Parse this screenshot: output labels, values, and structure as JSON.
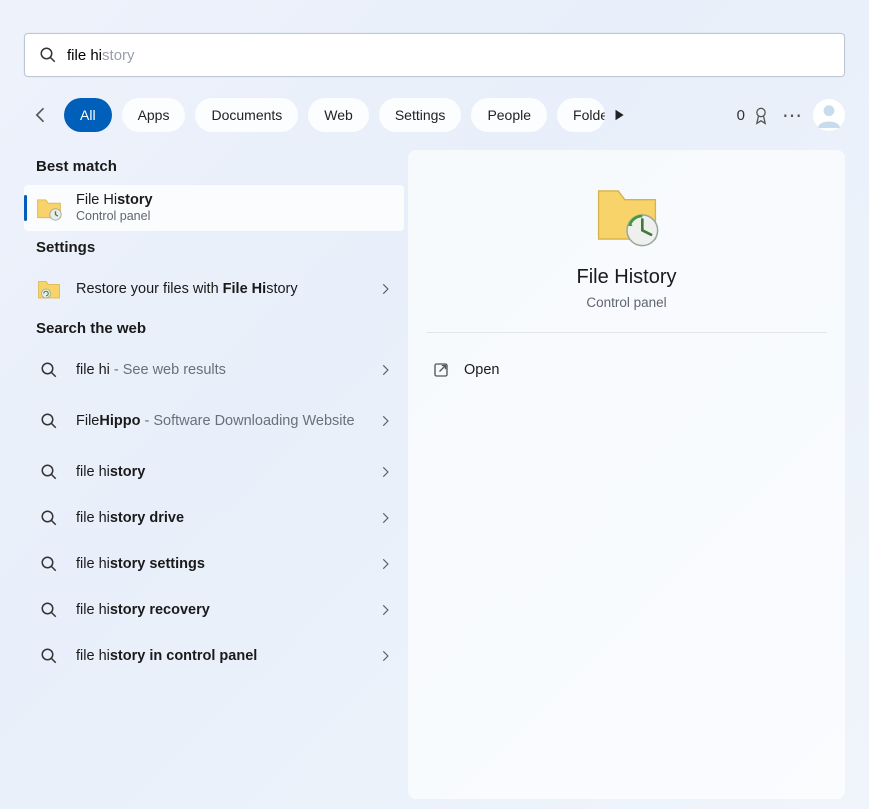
{
  "search": {
    "typed": "file hi",
    "completion": "story"
  },
  "tabs": {
    "items": [
      "All",
      "Apps",
      "Documents",
      "Web",
      "Settings",
      "People",
      "Folders"
    ],
    "active_index": 0
  },
  "points": {
    "value": "0"
  },
  "left": {
    "best_match_heading": "Best match",
    "best_match": {
      "title_prefix": "File Hi",
      "title_suffix": "story",
      "subtitle": "Control panel"
    },
    "settings_heading": "Settings",
    "settings_item": {
      "title_prefix": "Restore your files with ",
      "title_bold": "File Hi",
      "title_suffix": "story"
    },
    "web_heading": "Search the web",
    "web_items": [
      {
        "prefix": "file hi",
        "bold": "",
        "suffix": "",
        "trail": " - See web results"
      },
      {
        "prefix": "File",
        "bold": "Hippo",
        "suffix": "",
        "trail": " - Software Downloading Website",
        "tall": true
      },
      {
        "prefix": "file hi",
        "bold": "story",
        "suffix": "",
        "trail": ""
      },
      {
        "prefix": "file hi",
        "bold": "story drive",
        "suffix": "",
        "trail": ""
      },
      {
        "prefix": "file hi",
        "bold": "story settings",
        "suffix": "",
        "trail": ""
      },
      {
        "prefix": "file hi",
        "bold": "story recovery",
        "suffix": "",
        "trail": ""
      },
      {
        "prefix": "file hi",
        "bold": "story in control panel",
        "suffix": "",
        "trail": ""
      }
    ]
  },
  "detail": {
    "title": "File History",
    "subtitle": "Control panel",
    "action": "Open"
  }
}
